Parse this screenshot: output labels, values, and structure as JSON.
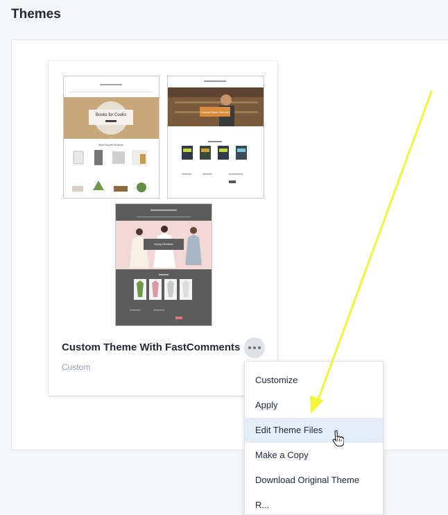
{
  "page": {
    "title": "Themes"
  },
  "theme_card": {
    "name": "Custom Theme With FastComments",
    "subtitle": "Custom",
    "previews": {
      "preview_1": {
        "heading": "Books for Cooks",
        "section": "Most Popular Products"
      },
      "preview_2": {
        "heading": "Artisanal Brands Welcome"
      },
      "preview_3": {
        "heading": "Spring Releases"
      }
    }
  },
  "actions_menu": {
    "items": [
      {
        "label": "Customize"
      },
      {
        "label": "Apply"
      },
      {
        "label": "Edit Theme Files"
      },
      {
        "label": "Make a Copy"
      },
      {
        "label": "Download Original Theme"
      },
      {
        "label": "R..."
      }
    ],
    "hovered_index": 2
  },
  "annotation": {
    "arrow_color": "#f4f536"
  },
  "colors": {
    "hover_bg": "#e3eef9",
    "more_button_bg": "#dfe3e8"
  }
}
